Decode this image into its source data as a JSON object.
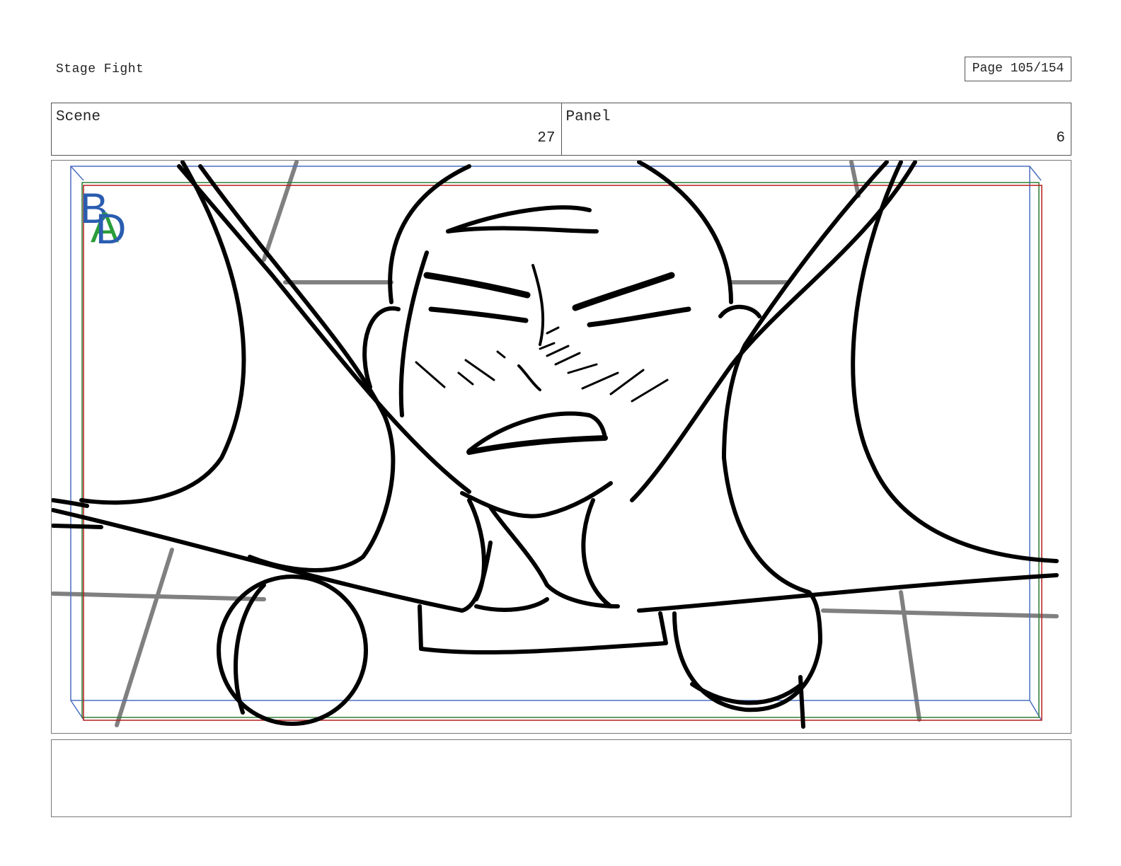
{
  "document": {
    "title": "Stage Fight",
    "page_label": "Page 105/154"
  },
  "header": {
    "scene_label": "Scene",
    "scene_number": "27",
    "panel_label": "Panel",
    "panel_number": "6"
  },
  "frame": {
    "watermark_text": "BDA",
    "guide_colors": {
      "safe_area": "#4a6fbf",
      "action_safe": "#2e7d32",
      "title_safe": "#b71c1c"
    },
    "ink_color": "#000000",
    "background_line_color": "#808080"
  },
  "notes": {
    "text": ""
  }
}
